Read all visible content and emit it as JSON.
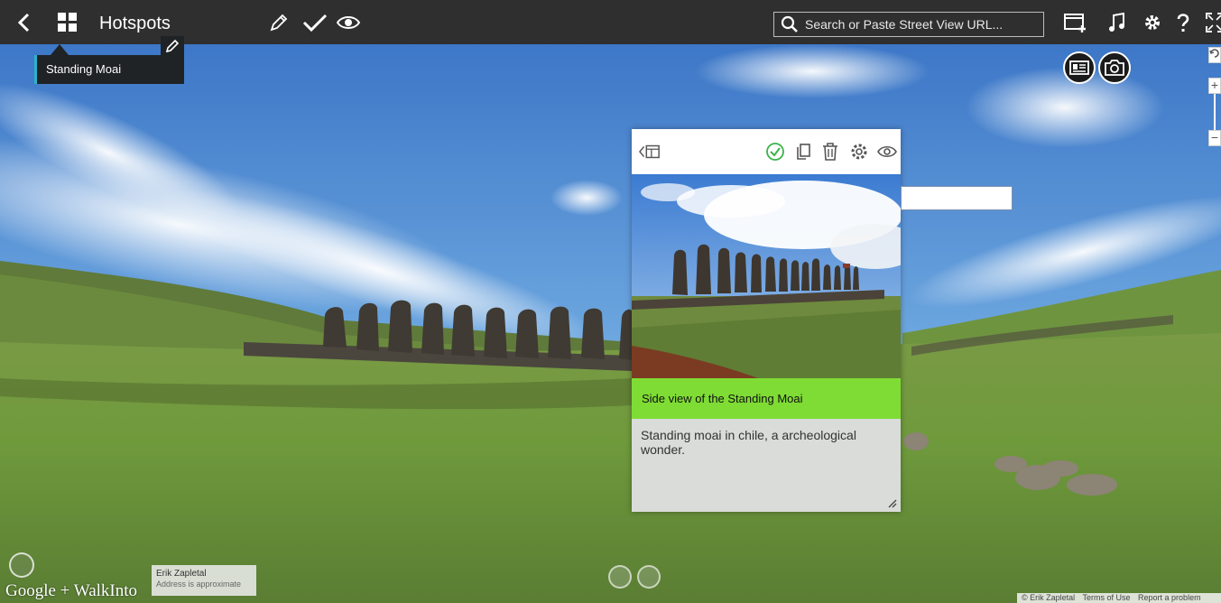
{
  "header": {
    "title": "Hotspots"
  },
  "search": {
    "placeholder": "Search or Paste Street View URL..."
  },
  "tooltip": {
    "label": "Standing Moai"
  },
  "card": {
    "title": "Side view of the Standing Moai",
    "description": "Standing moai in chile, a archeological wonder."
  },
  "attribution": {
    "author": "Erik Zapletal",
    "address_note": "Address is approximate"
  },
  "branding": {
    "logo_text": "Google + WalkInto"
  },
  "footer": {
    "copyright": "© Erik Zapletal",
    "terms": "Terms of Use",
    "report": "Report a problem"
  },
  "zoom": {
    "plus": "+",
    "minus": "−"
  },
  "colors": {
    "topbar": "#2f2f2f",
    "accent_green": "#7fdc35",
    "check_green": "#3cb34a",
    "tooltip_bg": "#1f2326",
    "tooltip_accent": "#2bb3c9"
  }
}
